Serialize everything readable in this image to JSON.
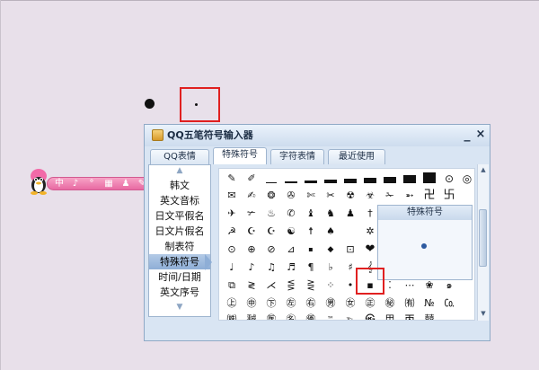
{
  "window": {
    "title": "QQ五笔符号输入器",
    "minimize": "_",
    "close": "×"
  },
  "tabs": [
    {
      "label": "QQ表情"
    },
    {
      "label": "特殊符号"
    },
    {
      "label": "字符表情"
    },
    {
      "label": "最近使用"
    }
  ],
  "sidebar": {
    "items": [
      {
        "label": "韩文"
      },
      {
        "label": "英文音标"
      },
      {
        "label": "日文平假名"
      },
      {
        "label": "日文片假名"
      },
      {
        "label": "制表符"
      },
      {
        "label": "特殊符号"
      },
      {
        "label": "时间/日期"
      },
      {
        "label": "英文序号"
      }
    ],
    "selected": "特殊符号"
  },
  "preview": {
    "title": "特殊符号"
  },
  "ime_toolbar": {
    "labels": [
      "中",
      "♪",
      "°",
      "▦",
      "♟",
      "✎"
    ]
  },
  "symbols": {
    "r1": [
      "✎",
      "✐",
      "",
      "",
      "",
      "",
      "",
      "",
      "",
      ""
    ],
    "r2": [
      "✉",
      "✍",
      "❂",
      "✇",
      "✄",
      "✂",
      "☢",
      "☣",
      "✁",
      "➵",
      "卍",
      "卐"
    ],
    "r3": [
      "✈",
      "✃",
      "♨",
      "✆",
      "♝",
      "♞",
      "♟",
      "†"
    ],
    "r4": [
      "☭",
      "☪",
      "☪",
      "☯",
      "☨",
      "♠",
      "✲"
    ],
    "r5": [
      "⊙",
      "⊕",
      "⊘",
      "⊿",
      "▪",
      "◆",
      "⊡",
      "❤"
    ],
    "r6": [
      "♩",
      "♪",
      "♫",
      "♬",
      "¶",
      "♭",
      "♯",
      "𝄞"
    ],
    "r7": [
      "⧉",
      "≷",
      "⋌",
      "⋚",
      "⋛",
      "⁘",
      "•",
      "▪",
      "⁚",
      "⋯",
      "❀",
      "๑"
    ],
    "r8": [
      "㊤",
      "㊥",
      "㊦",
      "㊧",
      "㊨",
      "㊚",
      "㊛",
      "㊣",
      "㊙",
      "㈲",
      "№",
      "㏇"
    ],
    "r9": [
      "㈱",
      "㍻",
      "㊩",
      "㊔",
      "㊝",
      "™",
      "℡",
      "㉿",
      "甲",
      "㆛",
      "囍"
    ]
  },
  "colors": {
    "accent": "#e02020",
    "selected_bg": "#8eaed6",
    "ime_pink": "#e86aa2"
  }
}
